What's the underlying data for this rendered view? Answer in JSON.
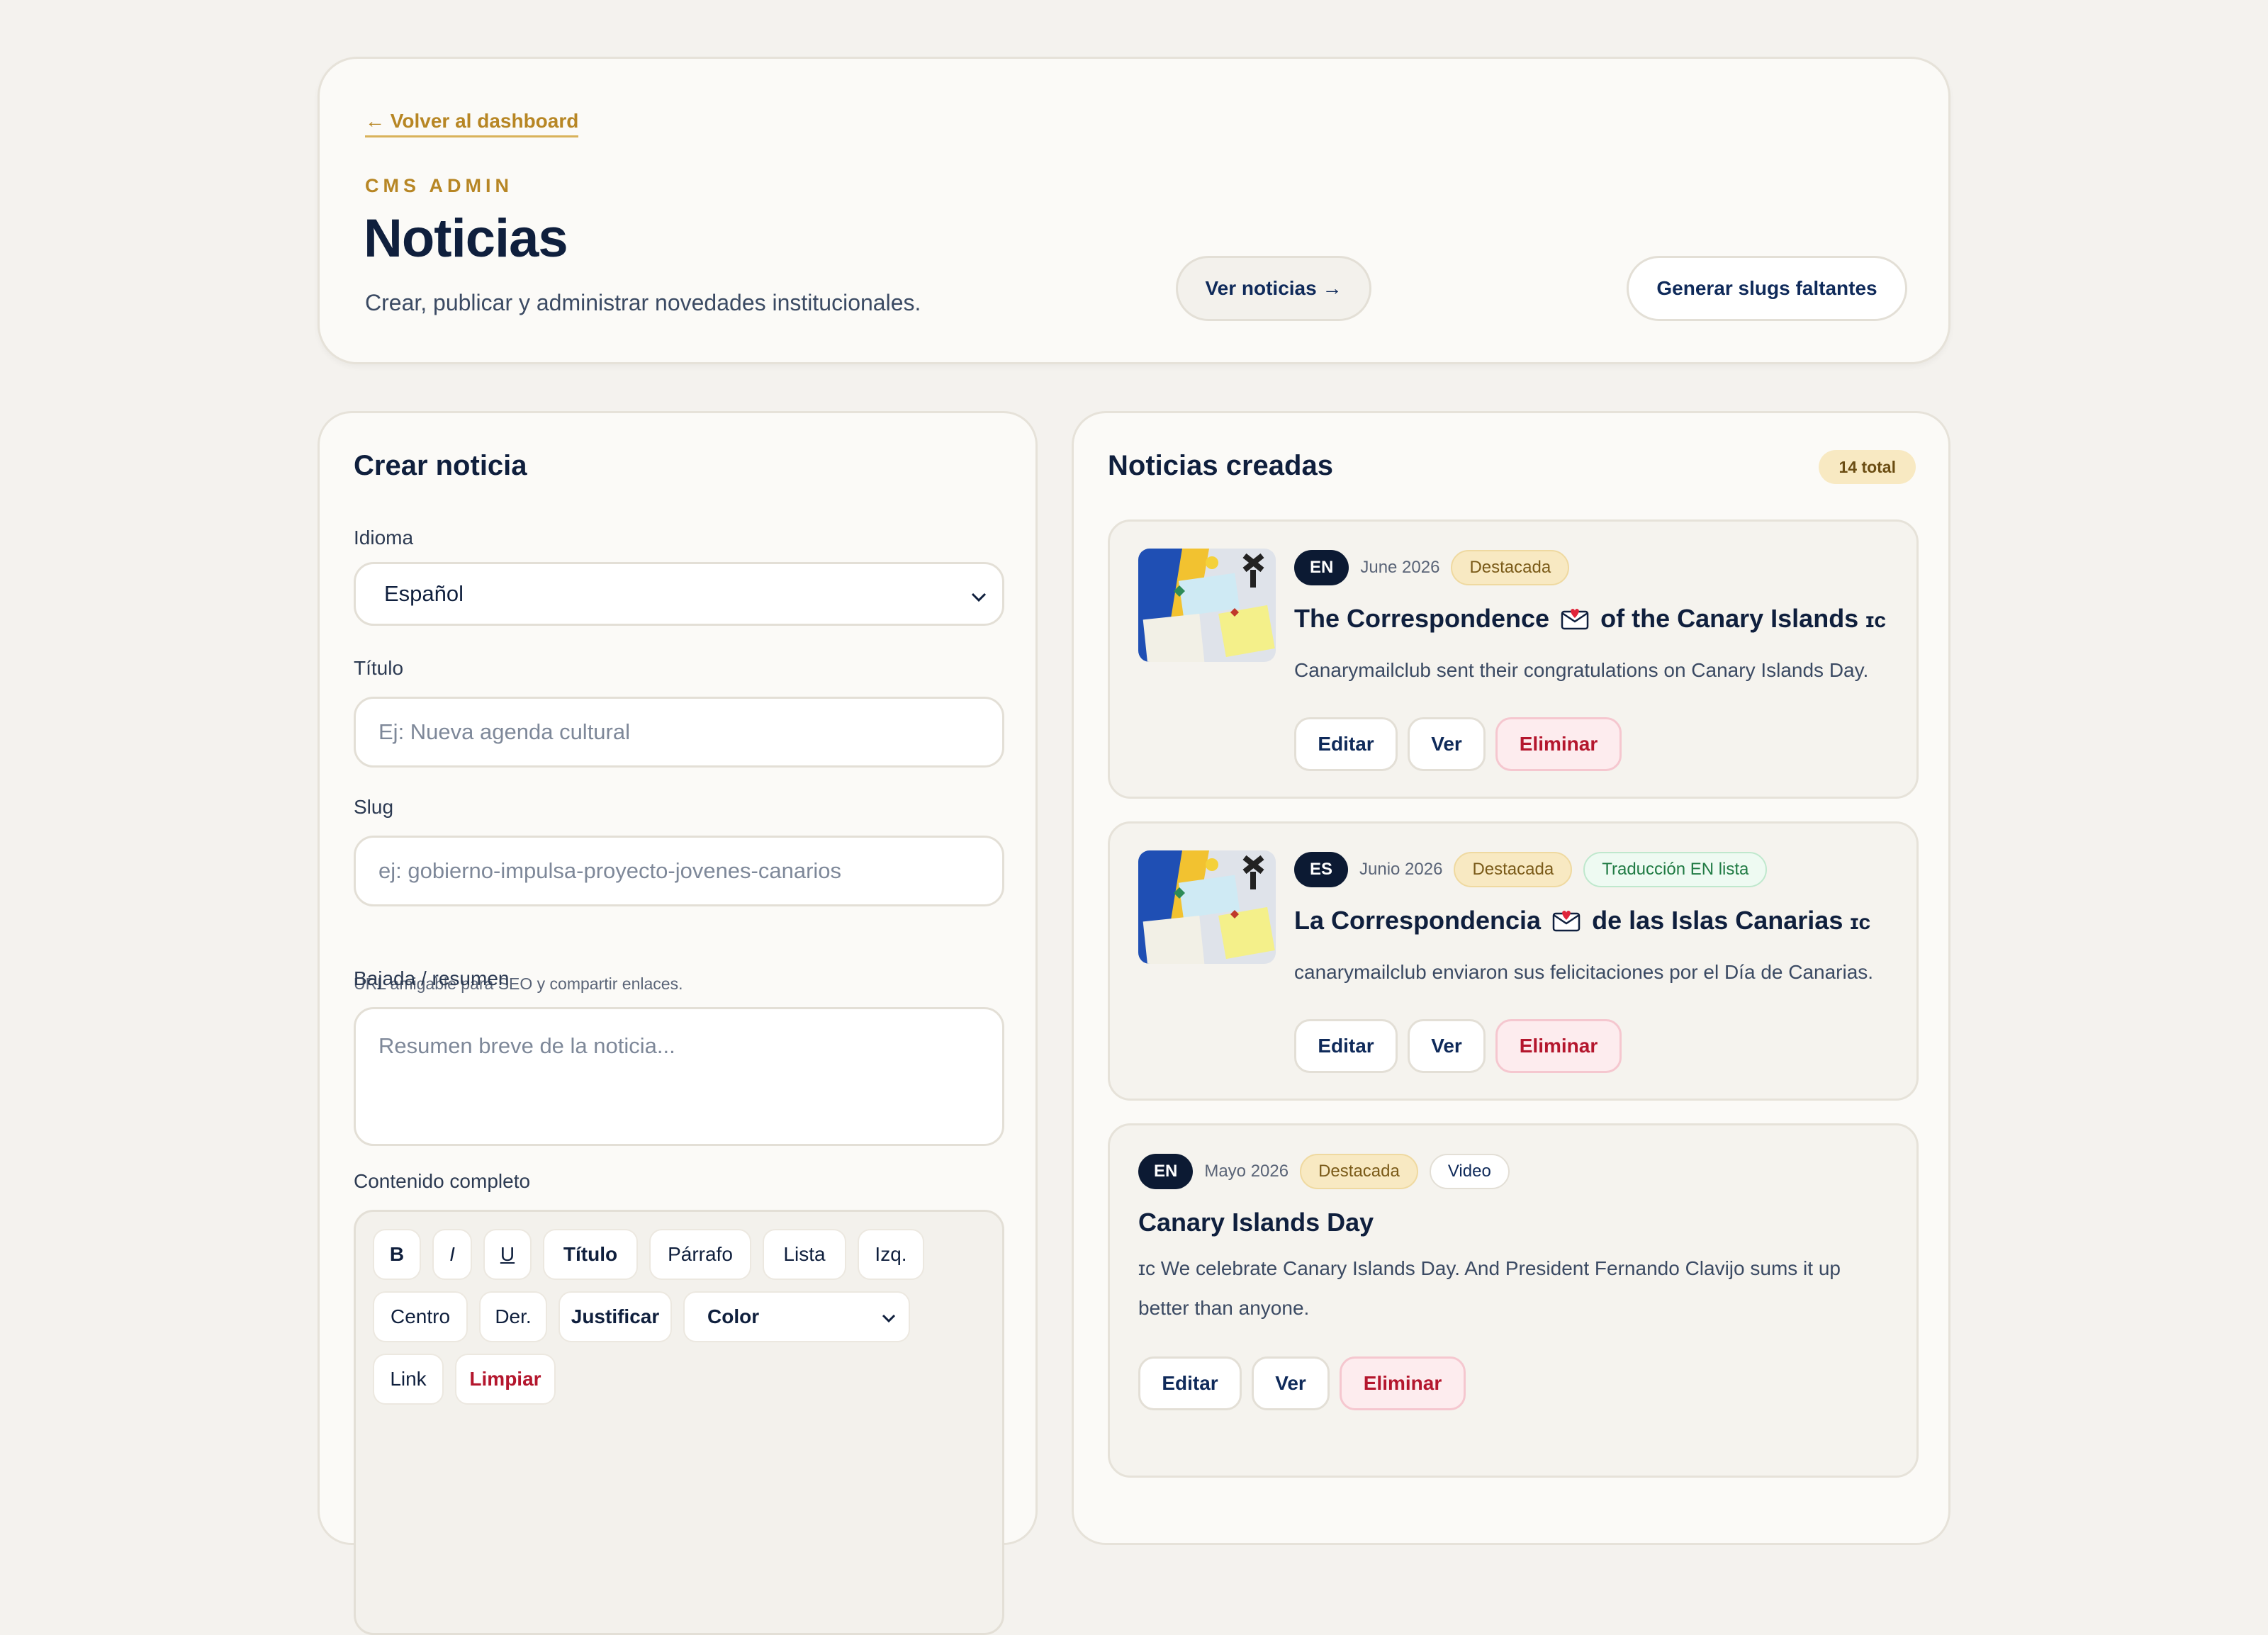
{
  "header": {
    "back_link": "← Volver al dashboard",
    "eyebrow": "CMS ADMIN",
    "title": "Noticias",
    "subtitle": "Crear, publicar y administrar novedades institucionales.",
    "view_news_button": "Ver noticias →",
    "generate_slugs_button": "Generar slugs faltantes"
  },
  "form": {
    "title": "Crear noticia",
    "language_label": "Idioma",
    "language_value": "Español",
    "title_label": "Título",
    "title_placeholder": "Ej: Nueva agenda cultural",
    "slug_label": "Slug",
    "slug_placeholder": "ej: gobierno-impulsa-proyecto-jovenes-canarios",
    "slug_hint": "URL amigable para SEO y compartir enlaces.",
    "summary_label": "Bajada / resumen",
    "summary_placeholder": "Resumen breve de la noticia...",
    "content_label": "Contenido completo",
    "toolbar": {
      "bold": "B",
      "italic": "I",
      "underline": "U",
      "heading": "Título",
      "paragraph": "Párrafo",
      "list": "Lista",
      "left": "Izq.",
      "center": "Centro",
      "right": "Der.",
      "justify": "Justificar",
      "color": "Color",
      "link": "Link",
      "clear": "Limpiar"
    }
  },
  "list": {
    "title": "Noticias creadas",
    "total_badge": "14 total",
    "items": [
      {
        "lang": "EN",
        "date": "June 2026",
        "tags": [
          "Destacada"
        ],
        "title_a": "The Correspondence",
        "title_b": "of the Canary Islands",
        "title_suffix": "ɪᴄ",
        "summary": "Canarymailclub sent their congratulations on Canary Islands Day.",
        "actions": [
          "Editar",
          "Ver",
          "Eliminar"
        ]
      },
      {
        "lang": "ES",
        "date": "Junio 2026",
        "tags": [
          "Destacada",
          "Traducción EN lista"
        ],
        "title_a": "La Correspondencia",
        "title_b": "de las Islas Canarias",
        "title_suffix": "ɪᴄ",
        "summary": "canarymailclub enviaron sus felicitaciones por el Día de Canarias.",
        "actions": [
          "Editar",
          "Ver",
          "Eliminar"
        ]
      },
      {
        "lang": "EN",
        "date": "Mayo 2026",
        "tags": [
          "Destacada",
          "Video"
        ],
        "title": "Canary Islands Day",
        "summary_prefix": "ɪᴄ",
        "summary_line1": "We celebrate Canary Islands Day. And President Fernando Clavijo sums it up",
        "summary_line2": "better than anyone.",
        "actions": [
          "Editar",
          "Ver",
          "Eliminar"
        ]
      }
    ]
  },
  "colors": {
    "background": "#f4f2ee",
    "accent_gold": "#b78624",
    "navy": "#0f1f3d",
    "danger": "#b4162d"
  }
}
